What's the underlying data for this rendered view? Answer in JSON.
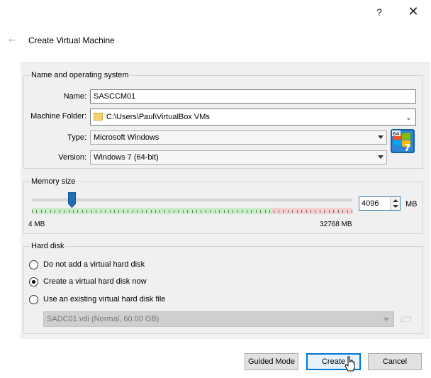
{
  "titlebar": {
    "help_glyph": "?",
    "close_glyph": "✕"
  },
  "wizard": {
    "back_glyph": "←",
    "title": "Create Virtual Machine"
  },
  "name_os": {
    "group_title": "Name and operating system",
    "name_label": "Name:",
    "name_value": "SASCCM01",
    "folder_label": "Machine Folder:",
    "folder_value": "C:\\Users\\Paul\\VirtualBox VMs",
    "type_label": "Type:",
    "type_value": "Microsoft Windows",
    "version_label": "Version:",
    "version_value": "Windows 7 (64-bit)",
    "os_icon": "windows-7-64-icon"
  },
  "memory": {
    "group_title": "Memory size",
    "value": "4096",
    "unit": "MB",
    "min_label": "4 MB",
    "max_label": "32768 MB",
    "slider_min": 4,
    "slider_max": 32768,
    "slider_value": 4096,
    "recommended_fraction": 0.75
  },
  "hard_disk": {
    "group_title": "Hard disk",
    "options": [
      {
        "label": "Do not add a virtual hard disk",
        "selected": false
      },
      {
        "label": "Create a virtual hard disk now",
        "selected": true
      },
      {
        "label": "Use an existing virtual hard disk file",
        "selected": false
      }
    ],
    "existing_file": "SADC01.vdi (Normal, 60.00 GB)"
  },
  "buttons": {
    "guided_mode": "Guided Mode",
    "create": "Create",
    "cancel": "Cancel"
  },
  "colors": {
    "accent": "#0078d7",
    "slider_thumb": "#1f6fb5",
    "good_range": "#c8eec8",
    "bad_range": "#f6cfcf"
  }
}
